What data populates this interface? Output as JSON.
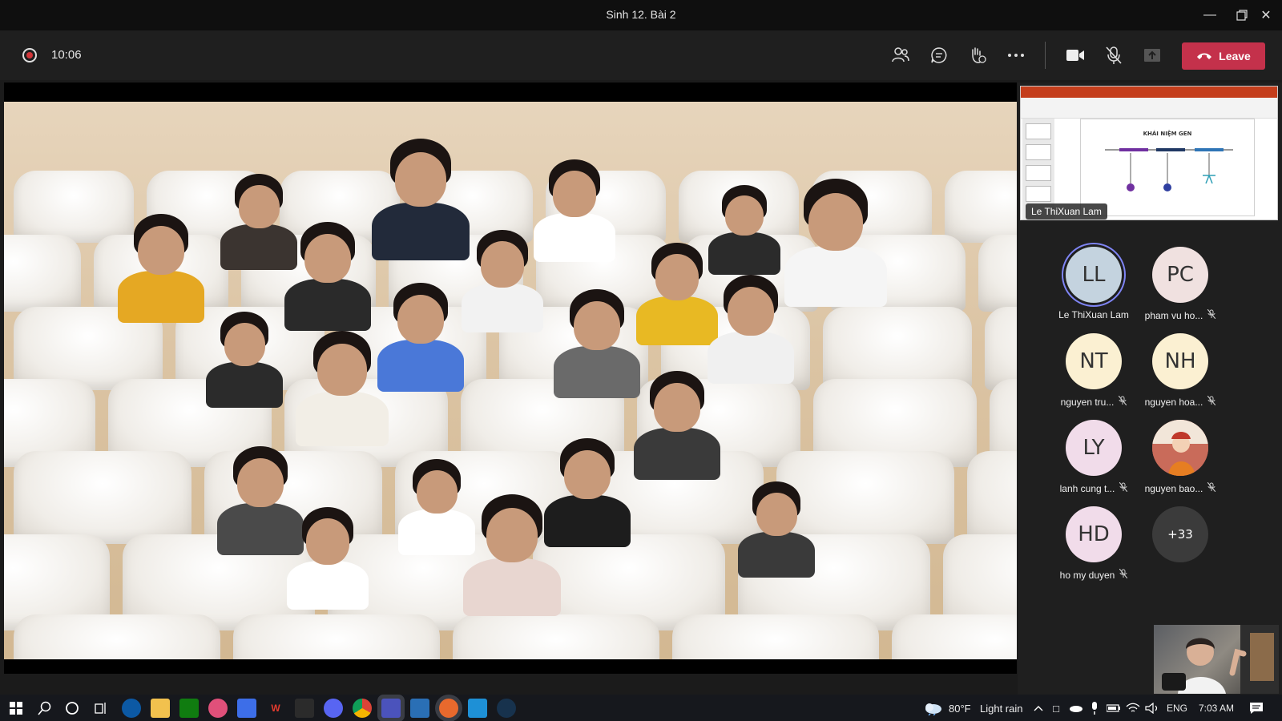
{
  "window": {
    "title": "Sinh 12. Bài 2",
    "minimize_icon": "minimize-icon",
    "restore_icon": "restore-icon",
    "close_icon": "close-icon"
  },
  "toolbar": {
    "recording_icon": "record-icon",
    "timer": "10:06",
    "people_icon": "people-icon",
    "chat_icon": "chat-icon",
    "reactions_icon": "raise-hand-icon",
    "more_icon": "more-options-icon",
    "camera_icon": "camera-icon",
    "mic_icon": "mic-off-icon",
    "share_icon": "share-icon",
    "leave_label": "Leave",
    "leave_color": "#c4314b"
  },
  "shared_screen": {
    "presenter": "Le ThiXuan Lam",
    "slide_title": "KHÁI NIỆM GEN"
  },
  "participants": [
    {
      "initials": "LL",
      "name": "Le ThiXuan Lam",
      "muted": false,
      "speaking": true,
      "color": "#c4d3df"
    },
    {
      "initials": "PC",
      "name": "pham vu ho...",
      "muted": true,
      "speaking": false,
      "color": "#f0e1e0"
    },
    {
      "initials": "NT",
      "name": "nguyen tru...",
      "muted": true,
      "speaking": false,
      "color": "#fbf0d2"
    },
    {
      "initials": "NH",
      "name": "nguyen hoa...",
      "muted": true,
      "speaking": false,
      "color": "#fbf0d2"
    },
    {
      "initials": "LY",
      "name": "lanh cung t...",
      "muted": true,
      "speaking": false,
      "color": "#f1dcea"
    },
    {
      "initials": "",
      "name": "nguyen bao...",
      "muted": true,
      "speaking": false,
      "color": "#c96b5a"
    },
    {
      "initials": "HD",
      "name": "ho my duyen",
      "muted": true,
      "speaking": false,
      "color": "#f1dcea"
    }
  ],
  "overflow_count": "+33",
  "taskbar": {
    "weather_temp": "80°F",
    "weather_desc": "Light rain",
    "language": "ENG",
    "time": "7:03 AM"
  }
}
